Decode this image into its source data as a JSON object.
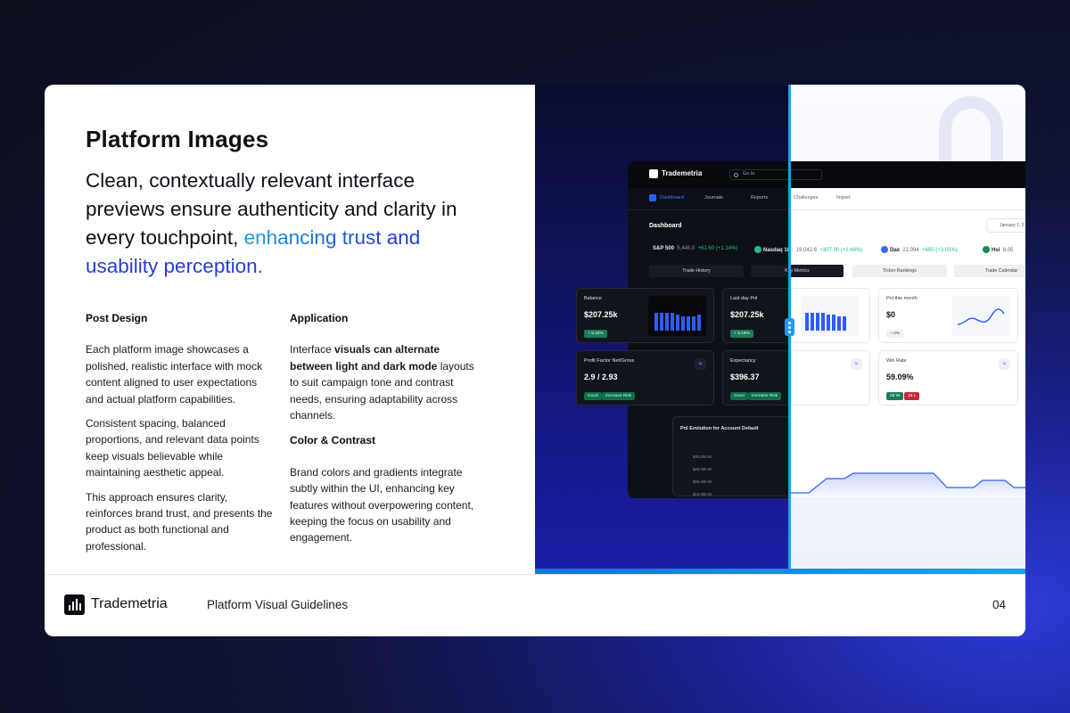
{
  "slide": {
    "title": "Platform Images",
    "headline_part1": "Clean, contextually relevant interface previews ensure authenticity and clarity in every touchpoint, ",
    "headline_accent": "enhancing trust and usability perception.",
    "accent_colors": [
      "#16a0e0",
      "#2a39d6"
    ],
    "columns": {
      "post_design": {
        "heading": "Post Design",
        "p1": "Each platform image showcases a polished, realistic interface with mock content aligned to user expectations and actual platform capabilities.",
        "p2": "Consistent spacing, balanced proportions, and relevant data points keep visuals believable while maintaining aesthetic appeal.",
        "p3": "This approach ensures clarity, reinforces brand trust, and presents the product as both functional and professional."
      },
      "application": {
        "heading": "Application",
        "p1_a": "Interface ",
        "p1_b": "visuals can alternate between light and dark mode",
        "p1_c": " layouts to suit campaign tone and contrast needs, ensuring adaptability across channels."
      },
      "color_contrast": {
        "heading": "Color & Contrast",
        "p1": "Brand colors and gradients integrate subtly within the UI, enhancing key features without overpowering content, keeping the focus on usability and engagement."
      }
    }
  },
  "footer": {
    "brand": "Trademetria",
    "title": "Platform Visual Guidelines",
    "page": "04"
  },
  "app": {
    "name": "Trademetria",
    "search_placeholder": "Go to",
    "nav": [
      "Dashboard",
      "Journals",
      "Reports",
      "Challenges",
      "Import"
    ],
    "dashboard_title": "Dashboard",
    "date": "January 1, 2",
    "tickers": [
      {
        "name": "S&P 500",
        "value": "5,445.0",
        "change": "+61.60 (+1.14%)"
      },
      {
        "name": "Nasdaq 100",
        "value": "19,042.6",
        "change": "+307.00 (+1.64%)"
      },
      {
        "name": "Dax",
        "value": "22,094",
        "change": "+650 (+3.03%)"
      },
      {
        "name": "Hsi",
        "value": "8,05"
      }
    ],
    "tabs": [
      "Trade History",
      "Key Metrics",
      "Ticker Rankings",
      "Trade Calendar"
    ],
    "cards": {
      "balance": {
        "label": "Balance",
        "value": "$207.25k",
        "badge": "+ 9.19%"
      },
      "last_day_pnl": {
        "label": "Last day Pnl",
        "value": "$207.25k",
        "badge": "+ 9.19%"
      },
      "pnl_month": {
        "label": "Pnl this month",
        "value": "$0",
        "badge": "~ 0%"
      },
      "profit_factor": {
        "label": "Profit Factor Net/Gross",
        "value": "2.9 / 2.93",
        "tags": [
          "Good",
          "Increase Risk"
        ]
      },
      "expectancy": {
        "label": "Expectancy",
        "value": "$396.37",
        "tags": [
          "Good",
          "Increase Risk"
        ]
      },
      "win_rate": {
        "label": "Win Rate",
        "value": "59.09%",
        "wins": "28 W",
        "losses": "18 L"
      }
    },
    "evolution": {
      "title": "Pnl Evolution for Account Default",
      "y_ticks": [
        "$30,000.00",
        "$25,000.00",
        "$20,000.00",
        "$15,000.00"
      ]
    }
  }
}
